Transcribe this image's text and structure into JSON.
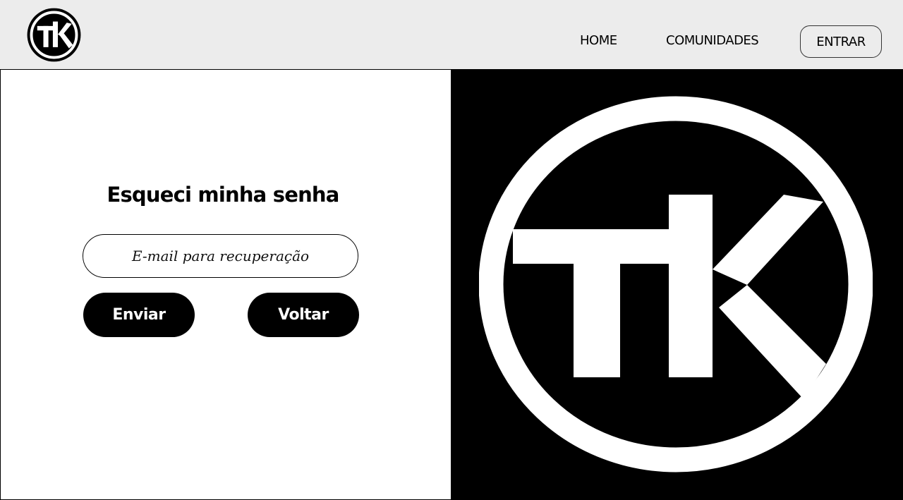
{
  "brand": {
    "logo_text": "TK"
  },
  "nav": {
    "home": "HOME",
    "comunidades": "COMUNIDADES",
    "entrar": "ENTRAR"
  },
  "form": {
    "title": "Esqueci minha senha",
    "email_placeholder": "E-mail para recuperação",
    "enviar_label": "Enviar",
    "voltar_label": "Voltar"
  },
  "colors": {
    "header_bg": "#ececec",
    "primary": "#000000",
    "on_primary": "#ffffff"
  },
  "icons": {
    "header_logo": "tk-logo-icon",
    "hero_logo": "tk-logo-icon"
  }
}
